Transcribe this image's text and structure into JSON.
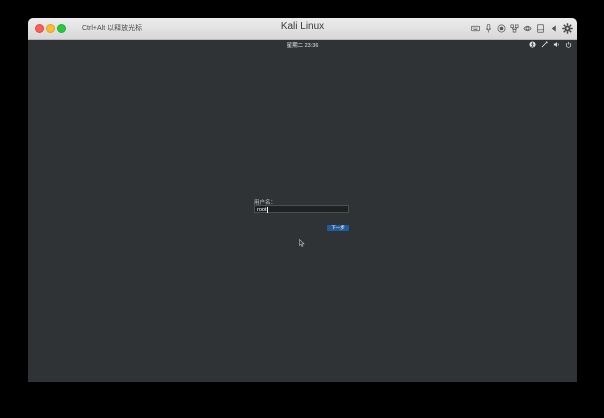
{
  "window": {
    "title": "Kali Linux",
    "capture_hint": "Ctrl+Alt 以释放光标"
  },
  "titlebar_icons": [
    "keyboard-icon",
    "microphone-icon",
    "record-icon",
    "network-icon",
    "printer-icon",
    "disk-icon",
    "volume-icon",
    "settings-icon"
  ],
  "vm_topbar": {
    "clock": "星期二 23:36",
    "right_icons": [
      "accessibility-icon",
      "network-icon",
      "volume-icon",
      "power-icon"
    ]
  },
  "login": {
    "username_label": "用户名：",
    "username_value": "root",
    "next_button": "下一步"
  },
  "colors": {
    "desktop_bg": "#2f3336",
    "button_blue": "#215d9c"
  }
}
